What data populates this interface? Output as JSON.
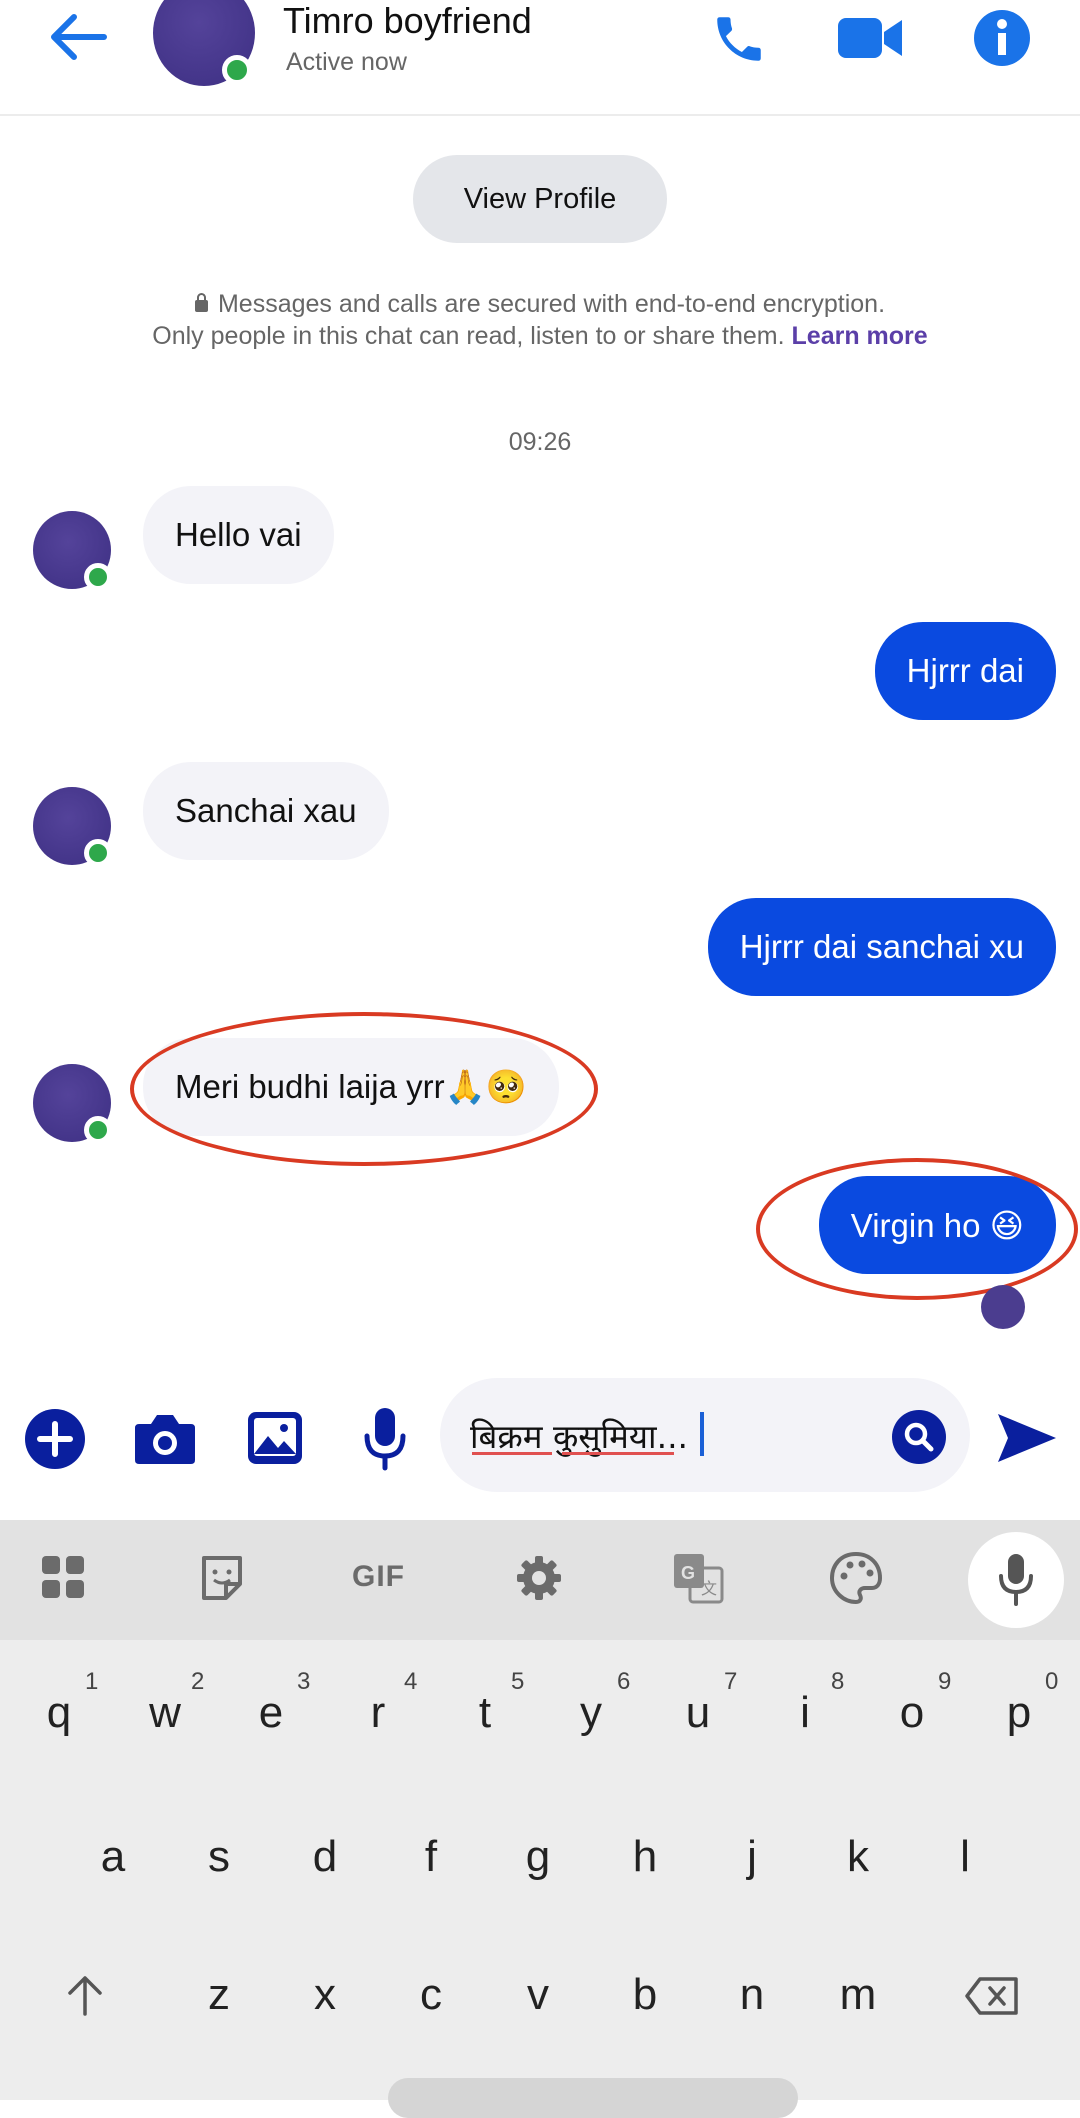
{
  "header": {
    "contact_name": "Timro boyfriend",
    "status": "Active now"
  },
  "profile": {
    "view_profile_label": "View Profile"
  },
  "encryption": {
    "line1": "Messages and calls are secured with end-to-end encryption.",
    "line2": "Only people in this chat can read, listen to or share them.",
    "learn_more": "Learn more"
  },
  "timestamp": "09:26",
  "messages": [
    {
      "from": "them",
      "text": "Hello vai"
    },
    {
      "from": "me",
      "text": "Hjrrr dai"
    },
    {
      "from": "them",
      "text": "Sanchai xau"
    },
    {
      "from": "me",
      "text": "Hjrrr dai sanchai xu"
    },
    {
      "from": "them",
      "text": "Meri budhi laija yrr🙏🥺"
    },
    {
      "from": "me",
      "text": "Virgin ho 😆"
    }
  ],
  "composer": {
    "input_value": "बिक्रम कुसुमिया..."
  },
  "keyboard": {
    "toolbar": [
      "apps-icon",
      "sticker-icon",
      "GIF",
      "settings-icon",
      "translate-icon",
      "theme-icon",
      "mic-icon"
    ],
    "gif_label": "GIF",
    "row1": [
      {
        "k": "q",
        "n": "1"
      },
      {
        "k": "w",
        "n": "2"
      },
      {
        "k": "e",
        "n": "3"
      },
      {
        "k": "r",
        "n": "4"
      },
      {
        "k": "t",
        "n": "5"
      },
      {
        "k": "y",
        "n": "6"
      },
      {
        "k": "u",
        "n": "7"
      },
      {
        "k": "i",
        "n": "8"
      },
      {
        "k": "o",
        "n": "9"
      },
      {
        "k": "p",
        "n": "0"
      }
    ],
    "row2": [
      "a",
      "s",
      "d",
      "f",
      "g",
      "h",
      "j",
      "k",
      "l"
    ],
    "row3": [
      "z",
      "x",
      "c",
      "v",
      "b",
      "n",
      "m"
    ]
  },
  "colors": {
    "accent_blue": "#0a4ae0",
    "header_icon_blue": "#1a73e8",
    "online_green": "#2ea84b",
    "highlight_red": "#d93a22",
    "learn_more_purple": "#5b3fa8"
  }
}
